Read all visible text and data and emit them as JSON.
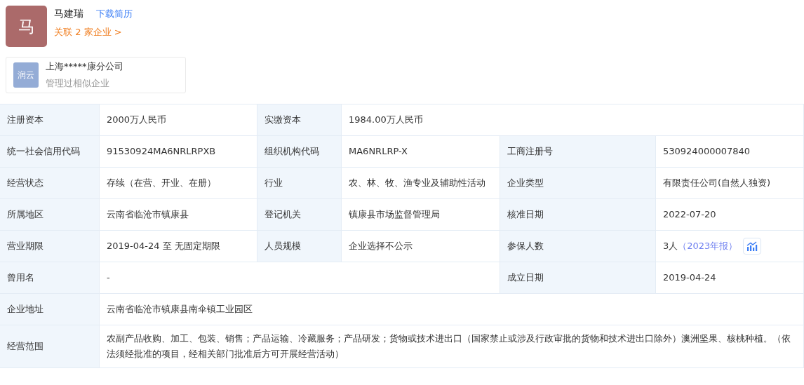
{
  "person": {
    "avatar": "马",
    "name": "马建瑞",
    "download_link": "下载简历",
    "related_link": "关联 2 家企业 >"
  },
  "company_card": {
    "logo": "润云",
    "name": "上海*****康分公司",
    "note": "管理过相似企业"
  },
  "table": {
    "rows": [
      {
        "pairs": [
          {
            "label": "注册资本",
            "value": "2000万人民币",
            "wide": false
          },
          {
            "label": "实缴资本",
            "value": "1984.00万人民币",
            "wide": true
          }
        ]
      },
      {
        "pairs": [
          {
            "label": "统一社会信用代码",
            "value": "91530924MA6NRLRPXB"
          },
          {
            "label": "组织机构代码",
            "value": "MA6NRLRP-X"
          },
          {
            "label": "工商注册号",
            "value": "530924000007840"
          }
        ]
      },
      {
        "pairs": [
          {
            "label": "经营状态",
            "value": "存续（在营、开业、在册）"
          },
          {
            "label": "行业",
            "value": "农、林、牧、渔专业及辅助性活动"
          },
          {
            "label": "企业类型",
            "value": "有限责任公司(自然人独资)"
          }
        ]
      },
      {
        "pairs": [
          {
            "label": "所属地区",
            "value": "云南省临沧市镇康县"
          },
          {
            "label": "登记机关",
            "value": "镇康县市场监督管理局"
          },
          {
            "label": "核准日期",
            "value": "2022-07-20"
          }
        ]
      },
      {
        "pairs": [
          {
            "label": "营业期限",
            "value": "2019-04-24 至 无固定期限"
          },
          {
            "label": "人员规模",
            "value": "企业选择不公示"
          },
          {
            "label": "参保人数",
            "value": "3人",
            "report_link": "（2023年报）",
            "chart_button": true
          }
        ]
      },
      {
        "pairs": [
          {
            "label": "曾用名",
            "value": "-",
            "wide": true
          },
          {
            "label": "成立日期",
            "value": "2019-04-24",
            "wide": false
          }
        ]
      },
      {
        "pairs": [
          {
            "label": "企业地址",
            "value": "云南省临沧市镇康县南伞镇工业园区"
          }
        ]
      },
      {
        "pairs": [
          {
            "label": "经营范围",
            "value": "农副产品收购、加工、包装、销售；产品运输、冷藏服务；产品研发；货物或技术进出口（国家禁止或涉及行政审批的货物和技术进出口除外）澳洲坚果、核桃种植。（依法须经批准的项目，经相关部门批准后方可开展经营活动）"
          }
        ]
      }
    ]
  }
}
